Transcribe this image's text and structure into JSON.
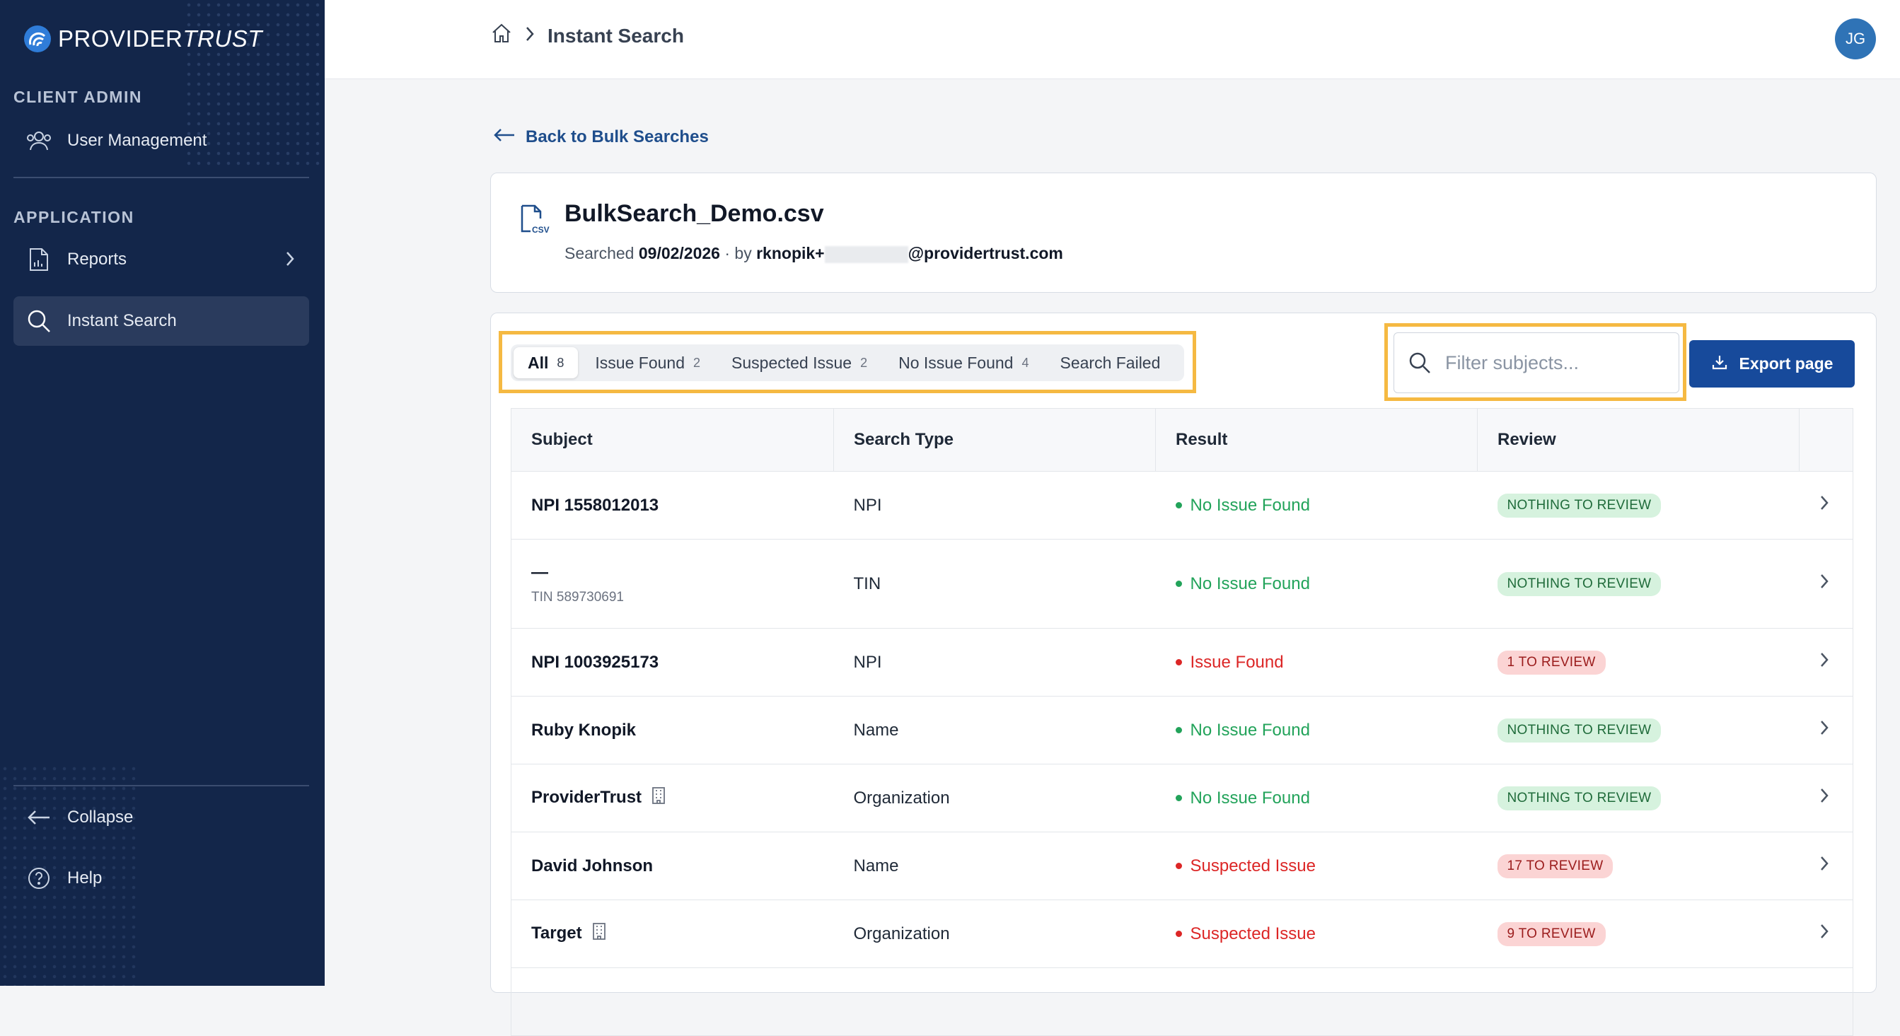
{
  "brand": {
    "name_bold": "PROVIDER",
    "name_italic": "TRUST"
  },
  "sidebar": {
    "sections": [
      {
        "label": "CLIENT ADMIN"
      },
      {
        "label": "APPLICATION"
      }
    ],
    "items": [
      {
        "label": "User Management",
        "icon": "users-icon"
      },
      {
        "label": "Reports",
        "icon": "report-icon"
      },
      {
        "label": "Instant Search",
        "icon": "search-icon",
        "active": true
      }
    ],
    "bottom": [
      {
        "label": "Collapse",
        "icon": "arrow-left-icon"
      },
      {
        "label": "Help",
        "icon": "help-circle-icon"
      }
    ]
  },
  "header": {
    "breadcrumb_title": "Instant Search",
    "avatar_initials": "JG"
  },
  "back_link": "Back to Bulk Searches",
  "file": {
    "name": "BulkSearch_Demo.csv",
    "searched_label": "Searched",
    "date": "09/02/2026",
    "by_label": " · by ",
    "user_prefix": "rknopik+",
    "user_domain": "@providertrust.com"
  },
  "tabs": [
    {
      "label": "All",
      "count": "8"
    },
    {
      "label": "Issue Found",
      "count": "2"
    },
    {
      "label": "Suspected Issue",
      "count": "2"
    },
    {
      "label": "No Issue Found",
      "count": "4"
    },
    {
      "label": "Search Failed",
      "count": ""
    }
  ],
  "filter": {
    "placeholder": "Filter subjects..."
  },
  "export_label": "Export page",
  "columns": [
    "Subject",
    "Search Type",
    "Result",
    "Review"
  ],
  "rows": [
    {
      "subject": "NPI 1558012013",
      "sub": "",
      "type": "NPI",
      "result": "No Issue Found",
      "review": "NOTHING TO REVIEW"
    },
    {
      "subject": "—",
      "sub": "TIN 589730691",
      "type": "TIN",
      "result": "No Issue Found",
      "review": "NOTHING TO REVIEW"
    },
    {
      "subject": "NPI 1003925173",
      "sub": "",
      "type": "NPI",
      "result": "Issue Found",
      "review": "1 TO REVIEW"
    },
    {
      "subject": "Ruby Knopik",
      "sub": "",
      "type": "Name",
      "result": "No Issue Found",
      "review": "NOTHING TO REVIEW"
    },
    {
      "subject": "ProviderTrust",
      "sub": "",
      "type": "Organization",
      "result": "No Issue Found",
      "review": "NOTHING TO REVIEW"
    },
    {
      "subject": "David Johnson",
      "sub": "",
      "type": "Name",
      "result": "Suspected Issue",
      "review": "17 TO REVIEW"
    },
    {
      "subject": "Target",
      "sub": "",
      "type": "Organization",
      "result": "Suspected Issue",
      "review": "9 TO REVIEW"
    }
  ],
  "colors": {
    "sidebar_bg": "#13264a",
    "primary": "#174a9b",
    "highlight": "#f5b942",
    "success": "#22a35a",
    "danger": "#dc2626"
  }
}
